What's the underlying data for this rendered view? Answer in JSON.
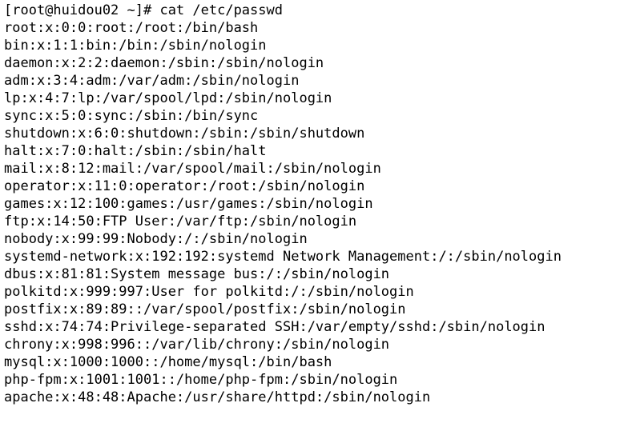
{
  "terminal": {
    "background_color": "#ffffff",
    "text_color": "#000000",
    "prompt": "[root@huidou02 ~]# cat /etc/passwd",
    "command": "cat /etc/passwd",
    "user": "root",
    "host": "huidou02",
    "cwd": "~",
    "prompt_symbol": "#",
    "lines": [
      "[root@huidou02 ~]# cat /etc/passwd",
      "root:x:0:0:root:/root:/bin/bash",
      "bin:x:1:1:bin:/bin:/sbin/nologin",
      "daemon:x:2:2:daemon:/sbin:/sbin/nologin",
      "adm:x:3:4:adm:/var/adm:/sbin/nologin",
      "lp:x:4:7:lp:/var/spool/lpd:/sbin/nologin",
      "sync:x:5:0:sync:/sbin:/bin/sync",
      "shutdown:x:6:0:shutdown:/sbin:/sbin/shutdown",
      "halt:x:7:0:halt:/sbin:/sbin/halt",
      "mail:x:8:12:mail:/var/spool/mail:/sbin/nologin",
      "operator:x:11:0:operator:/root:/sbin/nologin",
      "games:x:12:100:games:/usr/games:/sbin/nologin",
      "ftp:x:14:50:FTP User:/var/ftp:/sbin/nologin",
      "nobody:x:99:99:Nobody:/:/sbin/nologin",
      "systemd-network:x:192:192:systemd Network Management:/:/sbin/nologin",
      "dbus:x:81:81:System message bus:/:/sbin/nologin",
      "polkitd:x:999:997:User for polkitd:/:/sbin/nologin",
      "postfix:x:89:89::/var/spool/postfix:/sbin/nologin",
      "sshd:x:74:74:Privilege-separated SSH:/var/empty/sshd:/sbin/nologin",
      "chrony:x:998:996::/var/lib/chrony:/sbin/nologin",
      "mysql:x:1000:1000::/home/mysql:/bin/bash",
      "php-fpm:x:1001:1001::/home/php-fpm:/sbin/nologin",
      "apache:x:48:48:Apache:/usr/share/httpd:/sbin/nologin"
    ],
    "passwd_entries": [
      {
        "user": "root",
        "password": "x",
        "uid": "0",
        "gid": "0",
        "gecos": "root",
        "home": "/root",
        "shell": "/bin/bash"
      },
      {
        "user": "bin",
        "password": "x",
        "uid": "1",
        "gid": "1",
        "gecos": "bin",
        "home": "/bin",
        "shell": "/sbin/nologin"
      },
      {
        "user": "daemon",
        "password": "x",
        "uid": "2",
        "gid": "2",
        "gecos": "daemon",
        "home": "/sbin",
        "shell": "/sbin/nologin"
      },
      {
        "user": "adm",
        "password": "x",
        "uid": "3",
        "gid": "4",
        "gecos": "adm",
        "home": "/var/adm",
        "shell": "/sbin/nologin"
      },
      {
        "user": "lp",
        "password": "x",
        "uid": "4",
        "gid": "7",
        "gecos": "lp",
        "home": "/var/spool/lpd",
        "shell": "/sbin/nologin"
      },
      {
        "user": "sync",
        "password": "x",
        "uid": "5",
        "gid": "0",
        "gecos": "sync",
        "home": "/sbin",
        "shell": "/bin/sync"
      },
      {
        "user": "shutdown",
        "password": "x",
        "uid": "6",
        "gid": "0",
        "gecos": "shutdown",
        "home": "/sbin",
        "shell": "/sbin/shutdown"
      },
      {
        "user": "halt",
        "password": "x",
        "uid": "7",
        "gid": "0",
        "gecos": "halt",
        "home": "/sbin",
        "shell": "/sbin/halt"
      },
      {
        "user": "mail",
        "password": "x",
        "uid": "8",
        "gid": "12",
        "gecos": "mail",
        "home": "/var/spool/mail",
        "shell": "/sbin/nologin"
      },
      {
        "user": "operator",
        "password": "x",
        "uid": "11",
        "gid": "0",
        "gecos": "operator",
        "home": "/root",
        "shell": "/sbin/nologin"
      },
      {
        "user": "games",
        "password": "x",
        "uid": "12",
        "gid": "100",
        "gecos": "games",
        "home": "/usr/games",
        "shell": "/sbin/nologin"
      },
      {
        "user": "ftp",
        "password": "x",
        "uid": "14",
        "gid": "50",
        "gecos": "FTP User",
        "home": "/var/ftp",
        "shell": "/sbin/nologin"
      },
      {
        "user": "nobody",
        "password": "x",
        "uid": "99",
        "gid": "99",
        "gecos": "Nobody",
        "home": "/",
        "shell": "/sbin/nologin"
      },
      {
        "user": "systemd-network",
        "password": "x",
        "uid": "192",
        "gid": "192",
        "gecos": "systemd Network Management",
        "home": "/",
        "shell": "/sbin/nologin"
      },
      {
        "user": "dbus",
        "password": "x",
        "uid": "81",
        "gid": "81",
        "gecos": "System message bus",
        "home": "/",
        "shell": "/sbin/nologin"
      },
      {
        "user": "polkitd",
        "password": "x",
        "uid": "999",
        "gid": "997",
        "gecos": "User for polkitd",
        "home": "/",
        "shell": "/sbin/nologin"
      },
      {
        "user": "postfix",
        "password": "x",
        "uid": "89",
        "gid": "89",
        "gecos": "",
        "home": "/var/spool/postfix",
        "shell": "/sbin/nologin"
      },
      {
        "user": "sshd",
        "password": "x",
        "uid": "74",
        "gid": "74",
        "gecos": "Privilege-separated SSH",
        "home": "/var/empty/sshd",
        "shell": "/sbin/nologin"
      },
      {
        "user": "chrony",
        "password": "x",
        "uid": "998",
        "gid": "996",
        "gecos": "",
        "home": "/var/lib/chrony",
        "shell": "/sbin/nologin"
      },
      {
        "user": "mysql",
        "password": "x",
        "uid": "1000",
        "gid": "1000",
        "gecos": "",
        "home": "/home/mysql",
        "shell": "/bin/bash"
      },
      {
        "user": "php-fpm",
        "password": "x",
        "uid": "1001",
        "gid": "1001",
        "gecos": "",
        "home": "/home/php-fpm",
        "shell": "/sbin/nologin"
      },
      {
        "user": "apache",
        "password": "x",
        "uid": "48",
        "gid": "48",
        "gecos": "Apache",
        "home": "/usr/share/httpd",
        "shell": "/sbin/nologin"
      }
    ]
  }
}
